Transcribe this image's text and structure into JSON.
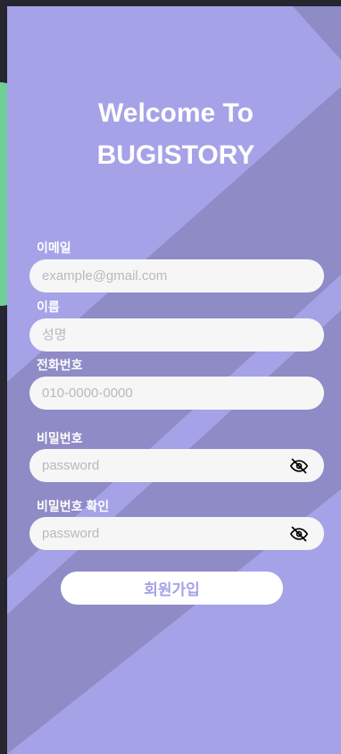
{
  "colors": {
    "background": "#a5a2e8",
    "stripe": "#8e8bc6",
    "accent_green": "#6fcf97"
  },
  "header": {
    "title_line1": "Welcome To",
    "title_line2": "BUGISTORY"
  },
  "form": {
    "email": {
      "label": "이메일",
      "placeholder": "example@gmail.com"
    },
    "name": {
      "label": "이름",
      "placeholder": "성명"
    },
    "phone": {
      "label": "전화번호",
      "placeholder": "010-0000-0000"
    },
    "password": {
      "label": "비밀번호",
      "placeholder": "password",
      "icon": "eye-off-icon"
    },
    "password_confirm": {
      "label": "비밀번호 확인",
      "placeholder": "password",
      "icon": "eye-off-icon"
    },
    "submit_label": "회원가입"
  }
}
